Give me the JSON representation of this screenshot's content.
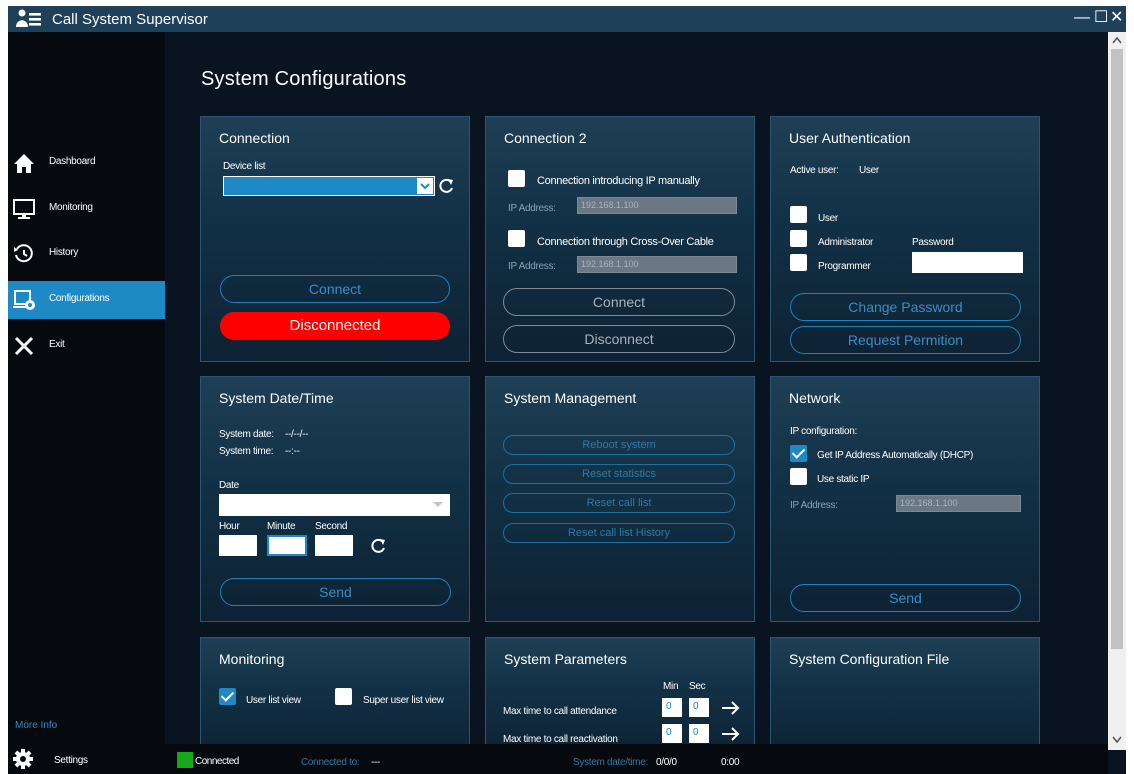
{
  "app": {
    "title": "Call System Supervisor"
  },
  "window_controls": {
    "minimize": "—",
    "maximize": "☐",
    "close": "✕"
  },
  "sidebar": {
    "items": [
      {
        "label": "Dashboard",
        "icon": "home-icon"
      },
      {
        "label": "Monitoring",
        "icon": "monitor-icon"
      },
      {
        "label": "History",
        "icon": "history-icon"
      },
      {
        "label": "Configurations",
        "icon": "configurations-icon",
        "active": true
      },
      {
        "label": "Exit",
        "icon": "close-icon"
      }
    ],
    "more_info": "More Info",
    "settings": "Settings"
  },
  "page": {
    "title": "System Configurations"
  },
  "connection": {
    "title": "Connection",
    "device_list_label": "Device list",
    "device_value": "",
    "connect_label": "Connect",
    "status_label": "Disconnected"
  },
  "connection2": {
    "title": "Connection 2",
    "manual_ip_label": "Connection introducing IP manually",
    "ip_label": "IP Address:",
    "ip_placeholder": "192.168.1.100",
    "crossover_label": "Connection through Cross-Over Cable",
    "ip_label2": "IP Address:",
    "ip_placeholder2": "192.168.1.100",
    "connect_label": "Connect",
    "disconnect_label": "Disconnect"
  },
  "user_auth": {
    "title": "User Authentication",
    "active_user_label": "Active user:",
    "active_user_value": "User",
    "options": [
      "User",
      "Administrator",
      "Programmer"
    ],
    "password_label": "Password",
    "change_password_label": "Change Password",
    "request_permission_label": "Request Permition"
  },
  "datetime": {
    "title": "System Date/Time",
    "system_date_label": "System date:",
    "system_date_value": "--/--/--",
    "system_time_label": "System time:",
    "system_time_value": "--:--",
    "date_label": "Date",
    "hour_label": "Hour",
    "minute_label": "Minute",
    "second_label": "Second",
    "send_label": "Send"
  },
  "management": {
    "title": "System Management",
    "buttons": [
      "Reboot system",
      "Reset statistics",
      "Reset call list",
      "Reset call list History"
    ]
  },
  "network": {
    "title": "Network",
    "ip_config_label": "IP configuration:",
    "dhcp_label": "Get IP Address Automatically (DHCP)",
    "dhcp_checked": true,
    "static_label": "Use static IP",
    "ip_label": "IP Address:",
    "ip_placeholder": "192.168.1.100",
    "send_label": "Send"
  },
  "monitoring_panel": {
    "title": "Monitoring",
    "user_list_label": "User list view",
    "user_list_checked": true,
    "super_user_label": "Super user list view"
  },
  "parameters": {
    "title": "System Parameters",
    "min_header": "Min",
    "sec_header": "Sec",
    "rows": [
      {
        "label": "Max time to call attendance",
        "min": "0",
        "sec": "0"
      },
      {
        "label": "Max time to call reactivation",
        "min": "0",
        "sec": "0"
      }
    ]
  },
  "config_file": {
    "title": "System Configuration File"
  },
  "status": {
    "connection": "Connected",
    "connected_to_label": "Connected to:",
    "connected_to_value": "---",
    "datetime_label": "System date/time:",
    "date_value": "0/0/0",
    "time_value": "0:00"
  },
  "colors": {
    "accent": "#1d8ac6",
    "danger": "#ff0000",
    "ok": "#18a81a",
    "titlebar": "#1e4058"
  }
}
